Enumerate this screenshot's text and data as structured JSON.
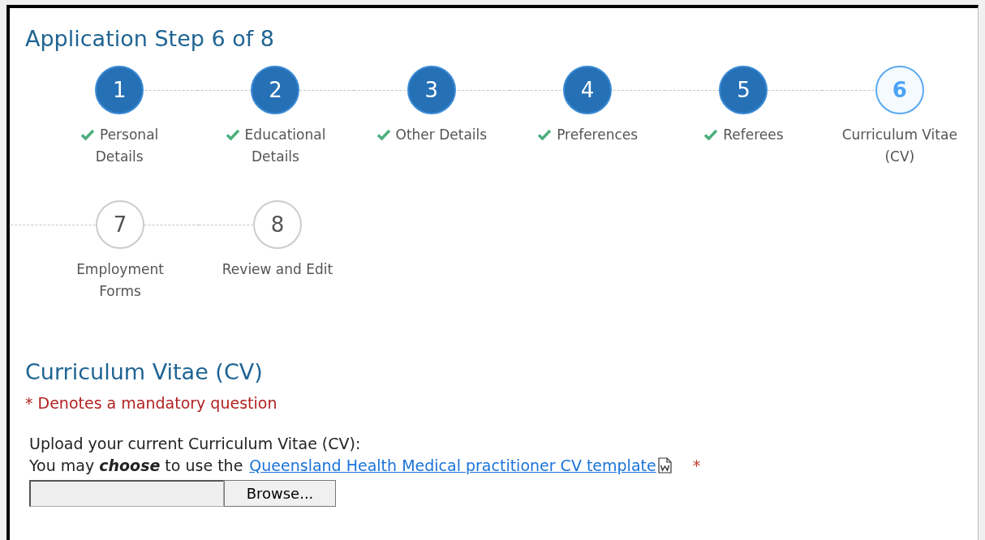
{
  "title": "Application Step 6 of 8",
  "steps": [
    {
      "number": "1",
      "label": "Personal Details",
      "completed": true,
      "selected": false
    },
    {
      "number": "2",
      "label": "Educational Details",
      "completed": true,
      "selected": false
    },
    {
      "number": "3",
      "label": "Other Details",
      "completed": true,
      "selected": false
    },
    {
      "number": "4",
      "label": "Preferences",
      "completed": true,
      "selected": false
    },
    {
      "number": "5",
      "label": "Referees",
      "completed": true,
      "selected": false
    },
    {
      "number": "6",
      "label": "Curriculum Vitae (CV)",
      "completed": false,
      "selected": true
    },
    {
      "number": "7",
      "label": "Employment Forms",
      "completed": false,
      "selected": false
    },
    {
      "number": "8",
      "label": "Review and Edit",
      "completed": false,
      "selected": false
    }
  ],
  "section": {
    "title": "Curriculum Vitae (CV)",
    "mandatory_note": "* Denotes a mandatory question",
    "upload_label": "Upload your current Curriculum Vitae (CV):",
    "template_text": "You may **choose** to use the",
    "template_link": "Queensland Health Medical practitioner CV template",
    "required_mark": "*",
    "browse_button": "Browse..."
  }
}
